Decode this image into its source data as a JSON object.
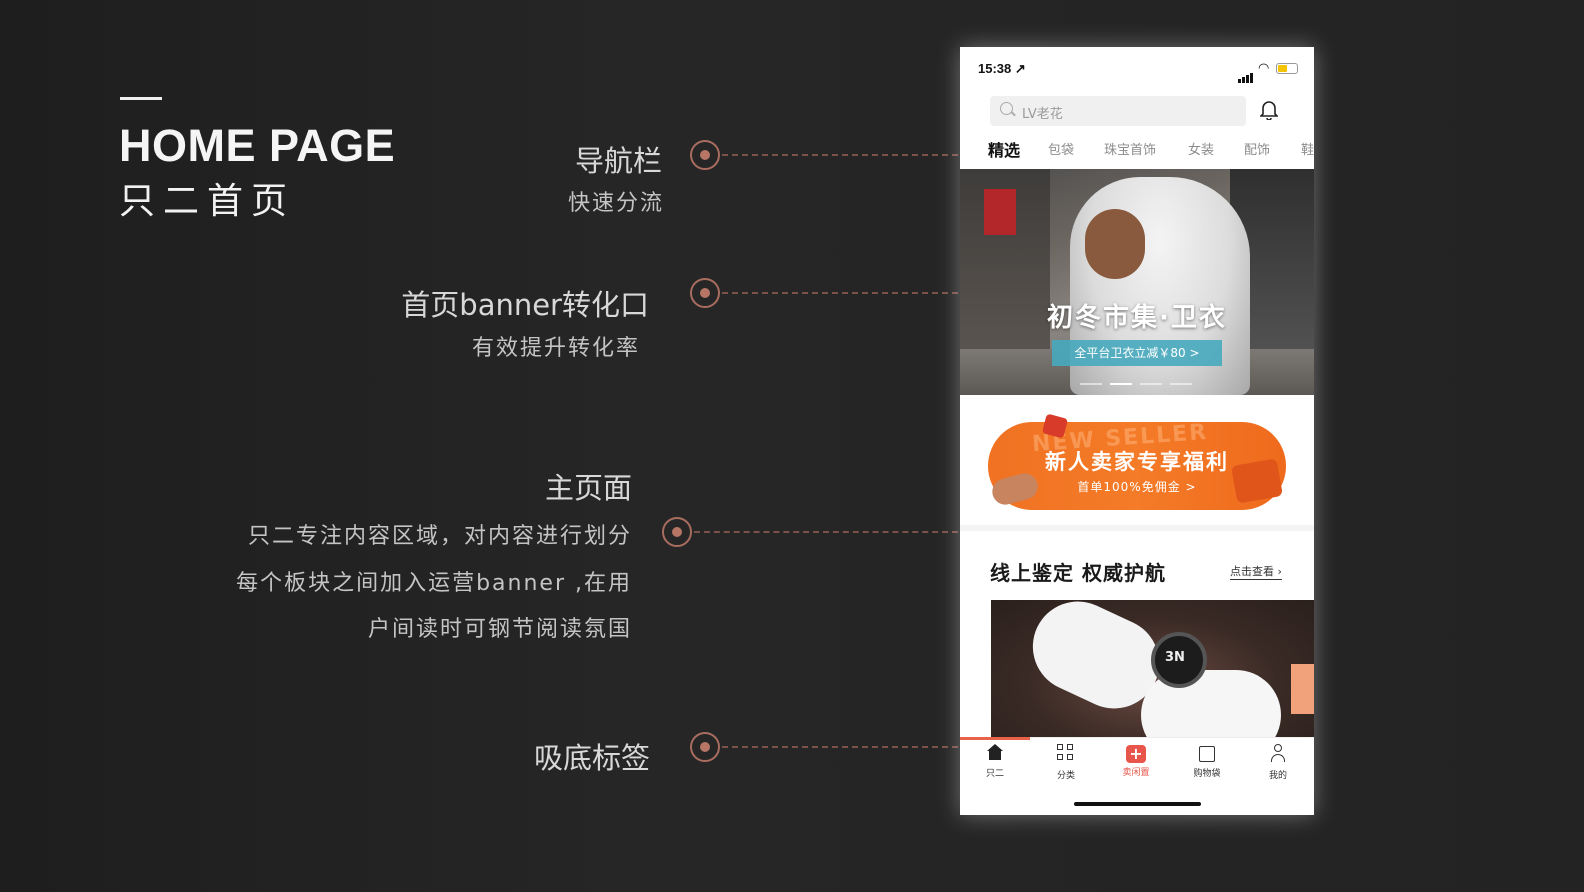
{
  "title": {
    "en": "HOME PAGE",
    "cn": "只二首页"
  },
  "annotations": {
    "nav": {
      "main": "导航栏",
      "sub": "快速分流"
    },
    "banner": {
      "main": "首页banner转化口",
      "sub": "有效提升转化率"
    },
    "main": {
      "main": "主页面",
      "sub1": "只二专注内容区域，对内容进行划分",
      "sub2": "每个板块之间加入运营banner ,在用",
      "sub3": "户间读时可钢节阅读氛国"
    },
    "tabbar": {
      "main": "吸底标签"
    }
  },
  "phone": {
    "status": {
      "time": "15:38 ↗"
    },
    "search": {
      "placeholder": "LV老花"
    },
    "tabs": [
      "精选",
      "包袋",
      "珠宝首饰",
      "女装",
      "配饰",
      "鞋"
    ],
    "banner": {
      "title": "初冬市集·卫衣",
      "pill": "全平台卫衣立减￥80 >"
    },
    "promo": {
      "ghost": "NEW SELLER",
      "title": "新人卖家专享福利",
      "sub": "首单100%免佣金 >"
    },
    "section": {
      "title": "线上鉴定 权威护航",
      "link": "点击查看 ›",
      "loupe_text": "3N"
    },
    "tabbar": [
      {
        "label": "只二",
        "icon": "home-icon"
      },
      {
        "label": "分类",
        "icon": "grid-icon"
      },
      {
        "label": "卖闲置",
        "icon": "plus-icon"
      },
      {
        "label": "购物袋",
        "icon": "bag-icon"
      },
      {
        "label": "我的",
        "icon": "user-icon"
      }
    ]
  },
  "colors": {
    "background": "#252525",
    "accent": "#b77665",
    "promo": "#f07222",
    "banner_pill": "#46aabe",
    "tab_hot": "#e8554a"
  }
}
